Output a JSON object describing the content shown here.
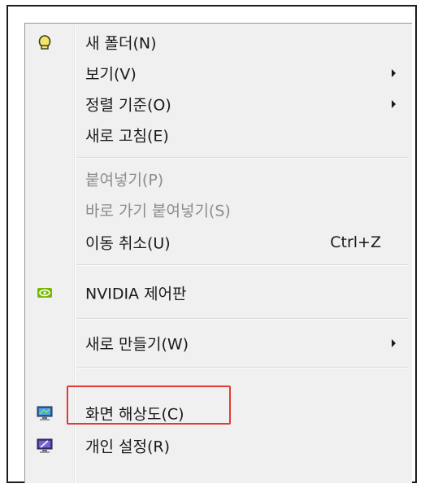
{
  "menu": {
    "items": [
      {
        "label": "새 폴더(N)",
        "icon": "folder-light-icon",
        "disabled": false
      },
      {
        "label": "보기(V)",
        "submenu": true
      },
      {
        "label": "정렬 기준(O)",
        "submenu": true
      },
      {
        "label": "새로 고침(E)"
      },
      {
        "label": "붙여넣기(P)",
        "disabled": true
      },
      {
        "label": "바로 가기 붙여넣기(S)",
        "disabled": true
      },
      {
        "label": "이동 취소(U)",
        "shortcut": "Ctrl+Z"
      },
      {
        "label": "NVIDIA 제어판",
        "icon": "nvidia-icon"
      },
      {
        "label": "새로 만들기(W)",
        "submenu": true
      },
      {
        "label": "화면 해상도(C)",
        "icon": "monitor-icon",
        "highlighted": true
      },
      {
        "label": "개인 설정(R)",
        "icon": "personalize-icon"
      }
    ]
  },
  "colors": {
    "menu_background": "#f0f0f0",
    "highlight_box": "#e53935",
    "disabled_text": "#8c8c8c"
  }
}
